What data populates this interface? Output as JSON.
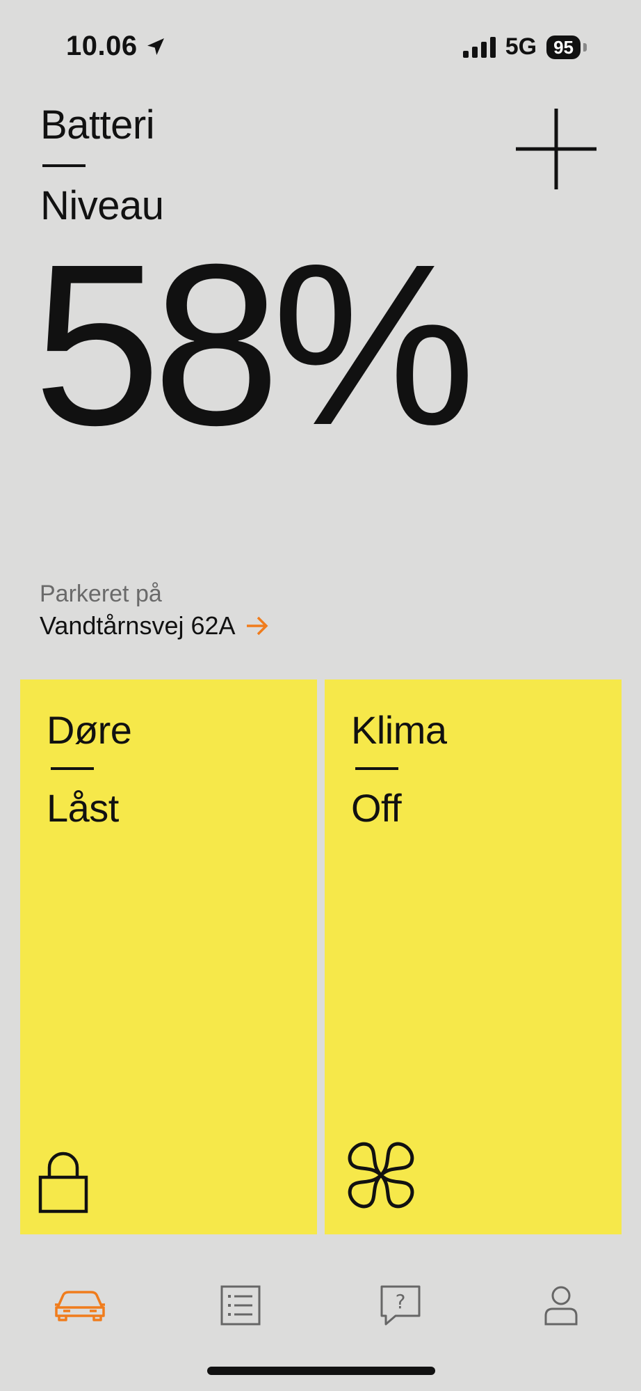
{
  "status_bar": {
    "time": "10.06",
    "network": "5G",
    "battery": "95"
  },
  "header": {
    "title": "Batteri",
    "subtitle": "Niveau",
    "battery_percent": "58%"
  },
  "parking": {
    "label": "Parkeret på",
    "address": "Vandtårnsvej 62A"
  },
  "cards": {
    "doors": {
      "title": "Døre",
      "value": "Låst",
      "icon": "lock-icon"
    },
    "climate": {
      "title": "Klima",
      "value": "Off",
      "icon": "fan-icon"
    }
  },
  "nav": {
    "items": [
      {
        "icon": "car-icon",
        "active": true
      },
      {
        "icon": "list-icon",
        "active": false
      },
      {
        "icon": "help-icon",
        "active": false
      },
      {
        "icon": "profile-icon",
        "active": false
      }
    ]
  },
  "colors": {
    "background": "#dcdcdb",
    "card": "#f6e84a",
    "accent": "#f07c1c",
    "text": "#111111",
    "muted": "#6a6a6a"
  }
}
